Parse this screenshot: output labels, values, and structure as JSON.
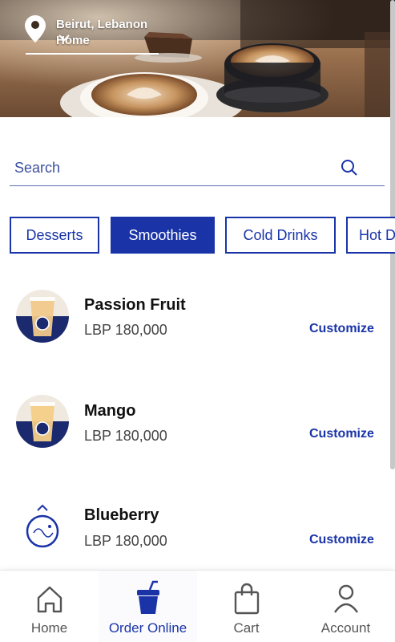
{
  "colors": {
    "brand": "#1a34a8",
    "text_dark": "#111111",
    "text_muted": "#444444"
  },
  "header": {
    "city": "Beirut, Lebanon",
    "address_label": "Home",
    "icons": [
      "location-pin-icon",
      "chevron-down-icon"
    ]
  },
  "search": {
    "placeholder": "Search",
    "value": "",
    "icon": "search-icon"
  },
  "categories": {
    "items": [
      {
        "label": "Desserts",
        "active": false
      },
      {
        "label": "Smoothies",
        "active": true
      },
      {
        "label": "Cold Drinks",
        "active": false
      },
      {
        "label": "Hot D",
        "active": false
      }
    ]
  },
  "products": [
    {
      "name": "Passion Fruit",
      "price": "LBP 180,000",
      "action": "Customize"
    },
    {
      "name": "Mango",
      "price": "LBP 180,000",
      "action": "Customize"
    },
    {
      "name": "Blueberry",
      "price": "LBP 180,000",
      "action": "Customize"
    }
  ],
  "bottom_nav": {
    "items": [
      {
        "label": "Home",
        "icon": "home-icon",
        "active": false
      },
      {
        "label": "Order Online",
        "icon": "drink-cup-icon",
        "active": true
      },
      {
        "label": "Cart",
        "icon": "shopping-bag-icon",
        "active": false
      },
      {
        "label": "Account",
        "icon": "user-icon",
        "active": false
      }
    ]
  }
}
